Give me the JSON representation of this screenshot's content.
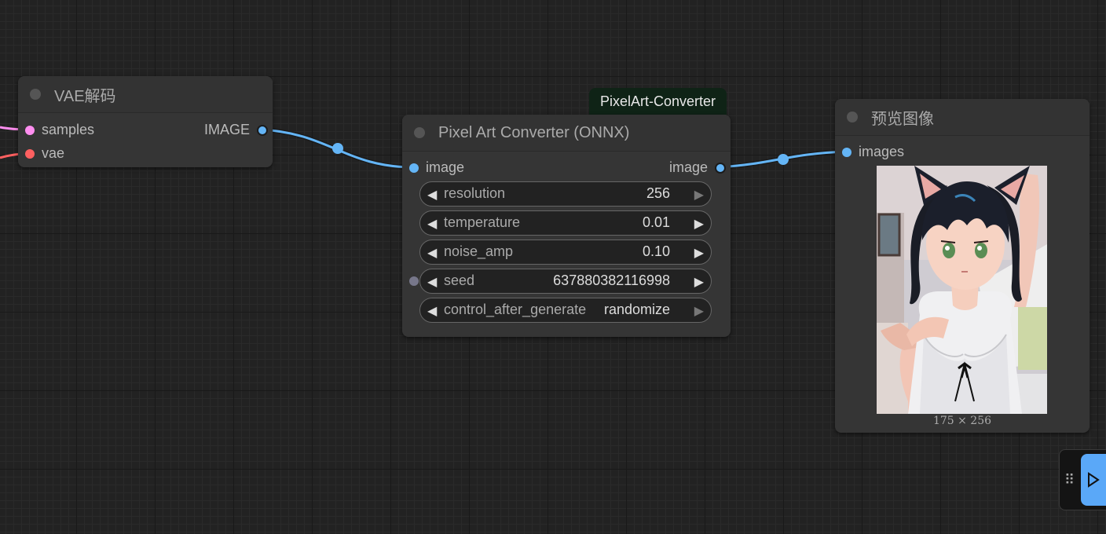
{
  "nodes": {
    "vae_decode": {
      "title": "VAE解码",
      "inputs": [
        {
          "label": "samples",
          "color": "#ff8ef0"
        },
        {
          "label": "vae",
          "color": "#ff6060"
        }
      ],
      "output": {
        "label": "IMAGE",
        "color": "#64b5f6"
      }
    },
    "pixel_art": {
      "badge": "PixelArt-Converter",
      "title": "Pixel Art Converter (ONNX)",
      "input": {
        "label": "image",
        "color": "#64b5f6"
      },
      "output": {
        "label": "image",
        "color": "#64b5f6"
      },
      "widgets": {
        "resolution": {
          "name": "resolution",
          "value": "256"
        },
        "temperature": {
          "name": "temperature",
          "value": "0.01"
        },
        "noise_amp": {
          "name": "noise_amp",
          "value": "0.10"
        },
        "seed": {
          "name": "seed",
          "value": "637880382116998"
        },
        "control": {
          "name": "control_after_generate",
          "value": "randomize"
        }
      }
    },
    "preview": {
      "title": "预览图像",
      "input": {
        "label": "images",
        "color": "#64b5f6"
      },
      "image_caption": "175 × 256"
    }
  },
  "colors": {
    "image_link": "#64b5f6",
    "latent_link": "#ff8ef0",
    "vae_link": "#ff6060",
    "run_button": "#5aa8f8"
  },
  "icons": {
    "decrement": "◀",
    "increment": "▶",
    "drag_handle": "⠿"
  }
}
